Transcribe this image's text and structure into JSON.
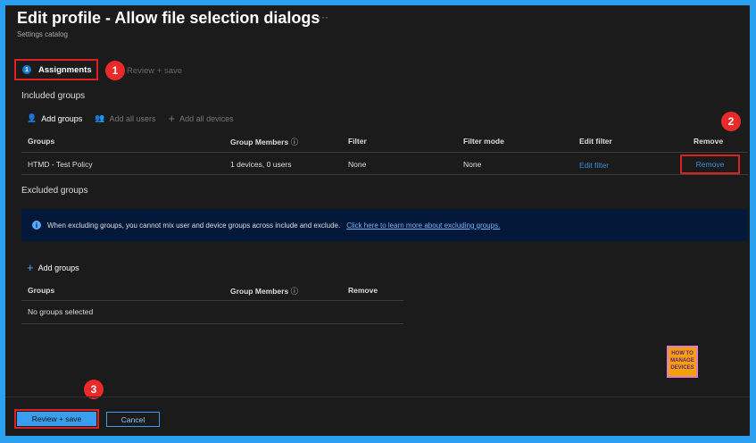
{
  "header": {
    "title": "Edit profile - Allow file selection dialogs",
    "more": "···",
    "subtitle": "Settings catalog"
  },
  "steps": [
    {
      "num": "1",
      "label": "Assignments"
    },
    {
      "label": "Review + save"
    }
  ],
  "callouts": [
    "1",
    "2",
    "3"
  ],
  "included": {
    "heading": "Included groups",
    "toolbar": [
      "Add groups",
      "Add all users",
      "Add all devices"
    ],
    "columns": [
      "Groups",
      "Group Members",
      "Filter",
      "Filter mode",
      "Edit filter",
      "Remove"
    ],
    "rows": [
      {
        "group": "HTMD - Test Policy",
        "members": "1 devices, 0 users",
        "filter": "None",
        "mode": "None",
        "edit": "Edit filter",
        "remove": "Remove"
      }
    ]
  },
  "excluded": {
    "heading": "Excluded groups",
    "info": "When excluding groups, you cannot mix user and device groups across include and exclude.",
    "info_link": "Click here to learn more about excluding groups.",
    "add": "Add groups",
    "columns": [
      "Groups",
      "Group Members",
      "Remove"
    ],
    "empty": "No groups selected"
  },
  "logo": {
    "text": "HOW TO MANAGE DEVICES"
  },
  "footer": {
    "primary": "Review + save",
    "cancel": "Cancel"
  }
}
